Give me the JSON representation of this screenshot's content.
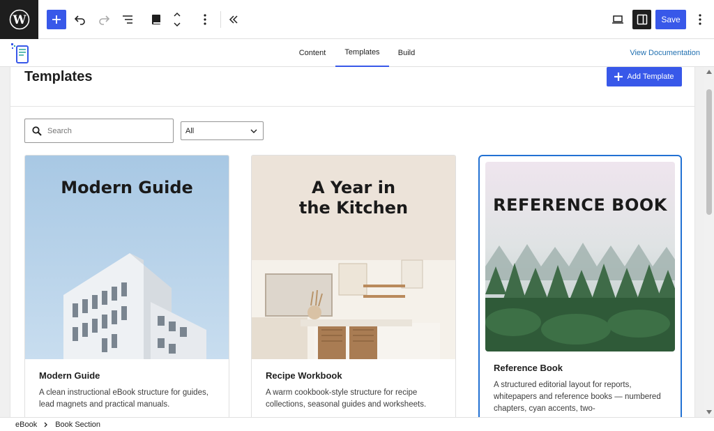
{
  "toolbar": {
    "save_label": "Save"
  },
  "plugin_nav": {
    "tabs": [
      {
        "label": "Content"
      },
      {
        "label": "Templates"
      },
      {
        "label": "Build"
      }
    ],
    "active_tab": "Templates",
    "view_documentation": "View Documentation"
  },
  "page": {
    "title": "Templates",
    "add_template_label": "Add Template"
  },
  "filters": {
    "search_placeholder": "Search",
    "select_value": "All"
  },
  "templates": [
    {
      "cover_title": "Modern Guide",
      "name": "Modern Guide",
      "description": "A clean instructional eBook structure for guides, lead magnets and practical manuals."
    },
    {
      "cover_title_line1": "A Year in",
      "cover_title_line2": "the Kitchen",
      "name": "Recipe Workbook",
      "description": "A warm cookbook-style structure for recipe collections, seasonal guides and worksheets."
    },
    {
      "cover_title": "REFERENCE BOOK",
      "name": "Reference Book",
      "description": "A structured editorial layout for reports, whitepapers and reference books — numbered chapters, cyan accents, two-",
      "selected": true
    }
  ],
  "breadcrumb": {
    "items": [
      "eBook",
      "Book Section"
    ]
  },
  "colors": {
    "accent": "#3858e9",
    "selected_border": "#2271d3",
    "link": "#2271b1"
  }
}
